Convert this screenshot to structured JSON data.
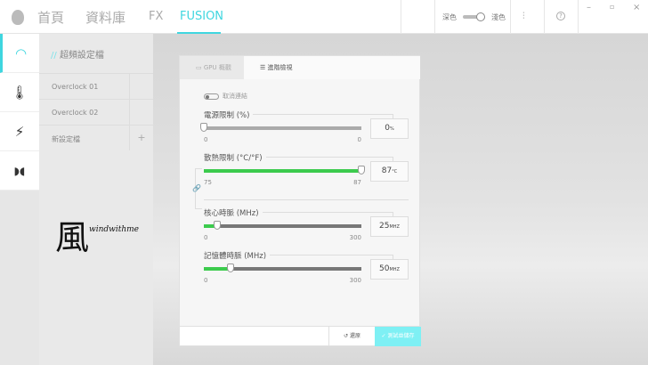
{
  "header": {
    "nav": [
      "首頁",
      "資料庫",
      "FX",
      "FUSION"
    ],
    "active": "FUSION",
    "theme_dark": "深色",
    "theme_light": "淺色",
    "theme": "light"
  },
  "rail": {
    "items": [
      "gauge-icon",
      "thermometer-icon",
      "power-plug-icon",
      "fusion-logo-icon"
    ]
  },
  "sidebar": {
    "title_prefix": "//",
    "title": "超頻設定檔",
    "profiles": [
      {
        "label": "Overclock 01",
        "active": true
      },
      {
        "label": "Overclock 02",
        "active": false
      },
      {
        "label": "新設定檔",
        "action": "+"
      }
    ]
  },
  "watermark": {
    "char": "風",
    "text": "windwithme"
  },
  "panel": {
    "tabs": [
      "GPU 概觀",
      "進階檢視"
    ],
    "active_tab": "進階檢視",
    "unlink_label": "取消連結",
    "sliders": [
      {
        "label": "電源限制 (%)",
        "min": "0",
        "max": "0",
        "value": "0",
        "unit": "%",
        "fraction": 0,
        "color": "#999999"
      },
      {
        "label": "散熱限制 (°C/°F)",
        "min": "75",
        "max": "87",
        "value": "87",
        "unit": "°C",
        "fraction": 1,
        "color": "#3ccb4d"
      },
      {
        "label": "核心時脈 (MHz)",
        "min": "0",
        "max": "300",
        "value": "25",
        "unit": "MHZ",
        "fraction": 0.083,
        "color": "#3ccb4d"
      },
      {
        "label": "記憶體時脈 (MHz)",
        "min": "0",
        "max": "300",
        "value": "50",
        "unit": "MHZ",
        "fraction": 0.167,
        "color": "#3ccb4d"
      }
    ],
    "revert_label": "還原",
    "save_label": "測試並儲存"
  },
  "colors": {
    "accent": "#3fd6df",
    "green": "#3ccb4d"
  }
}
